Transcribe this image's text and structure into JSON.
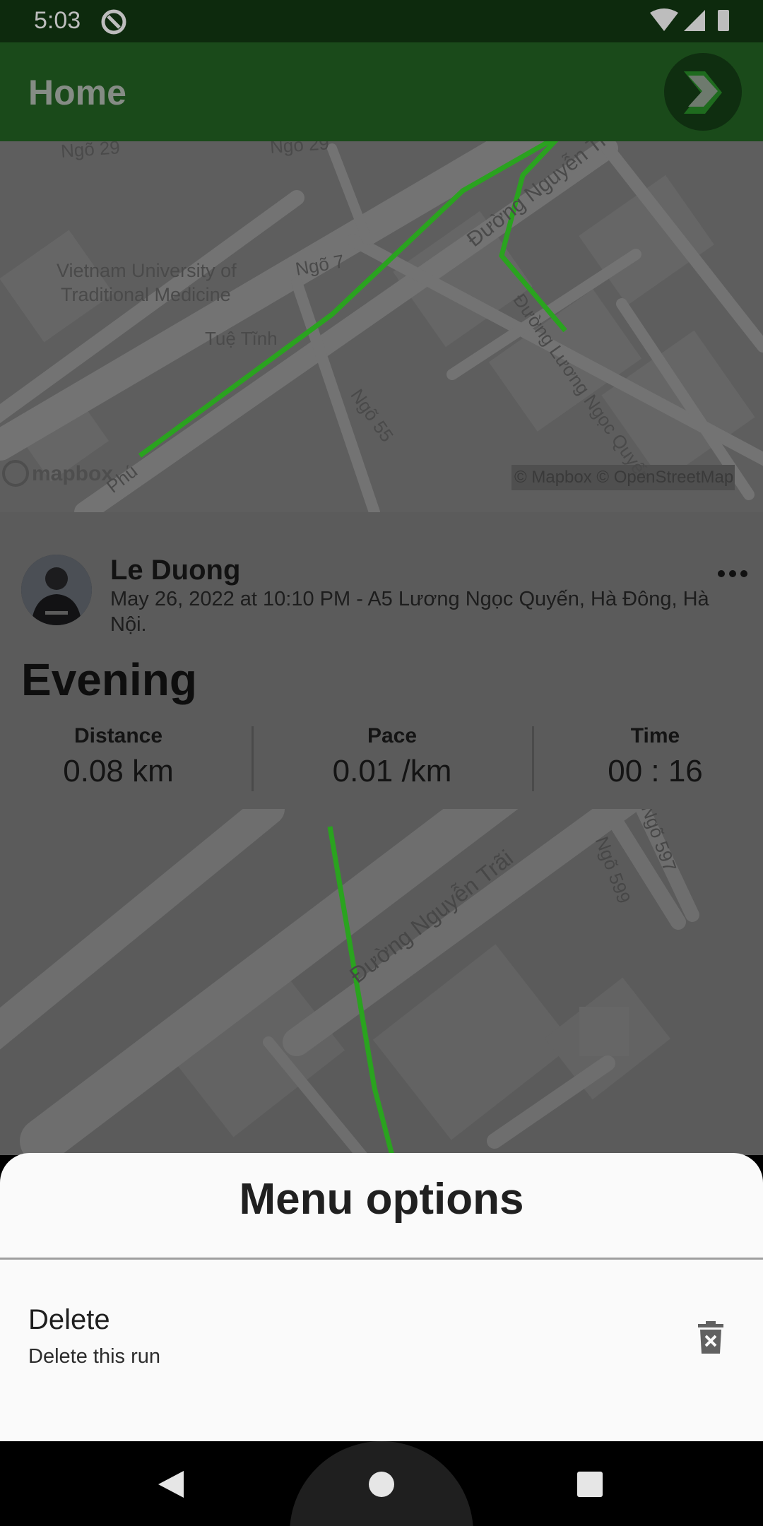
{
  "status_bar": {
    "time": "5:03"
  },
  "app_bar": {
    "title": "Home"
  },
  "map_top": {
    "labels": [
      "Ngõ 29",
      "Ngõ 29",
      "Vietnam University of",
      "Traditional Medicine",
      "Ngõ 7",
      "Tuệ Tĩnh",
      "Đường Nguyễn Tr",
      "Đường Lương Ngọc Quyến",
      "Ngõ 55",
      "Phú"
    ],
    "logo": "mapbox",
    "attribution": "© Mapbox © OpenStreetMap"
  },
  "card": {
    "user_name": "Le Duong",
    "meta": "May 26, 2022 at 10:10 PM - A5 Lương Ngọc Quyến, Hà Đông, Hà Nội.",
    "title": "Evening",
    "stats": [
      {
        "label": "Distance",
        "value": "0.08 km"
      },
      {
        "label": "Pace",
        "value": "0.01 /km"
      },
      {
        "label": "Time",
        "value": "00 : 16"
      }
    ]
  },
  "map_bottom": {
    "labels": [
      "Đường Nguyễn Trãi",
      "Ngõ 599",
      "Ngõ 597"
    ]
  },
  "sheet": {
    "title": "Menu options",
    "items": [
      {
        "title": "Delete",
        "subtitle": "Delete this run",
        "icon": "trash-icon"
      }
    ]
  },
  "colors": {
    "route": "#2aa31f",
    "app_bar": "#1a4a1a",
    "sheet_bg": "#fafafa"
  }
}
